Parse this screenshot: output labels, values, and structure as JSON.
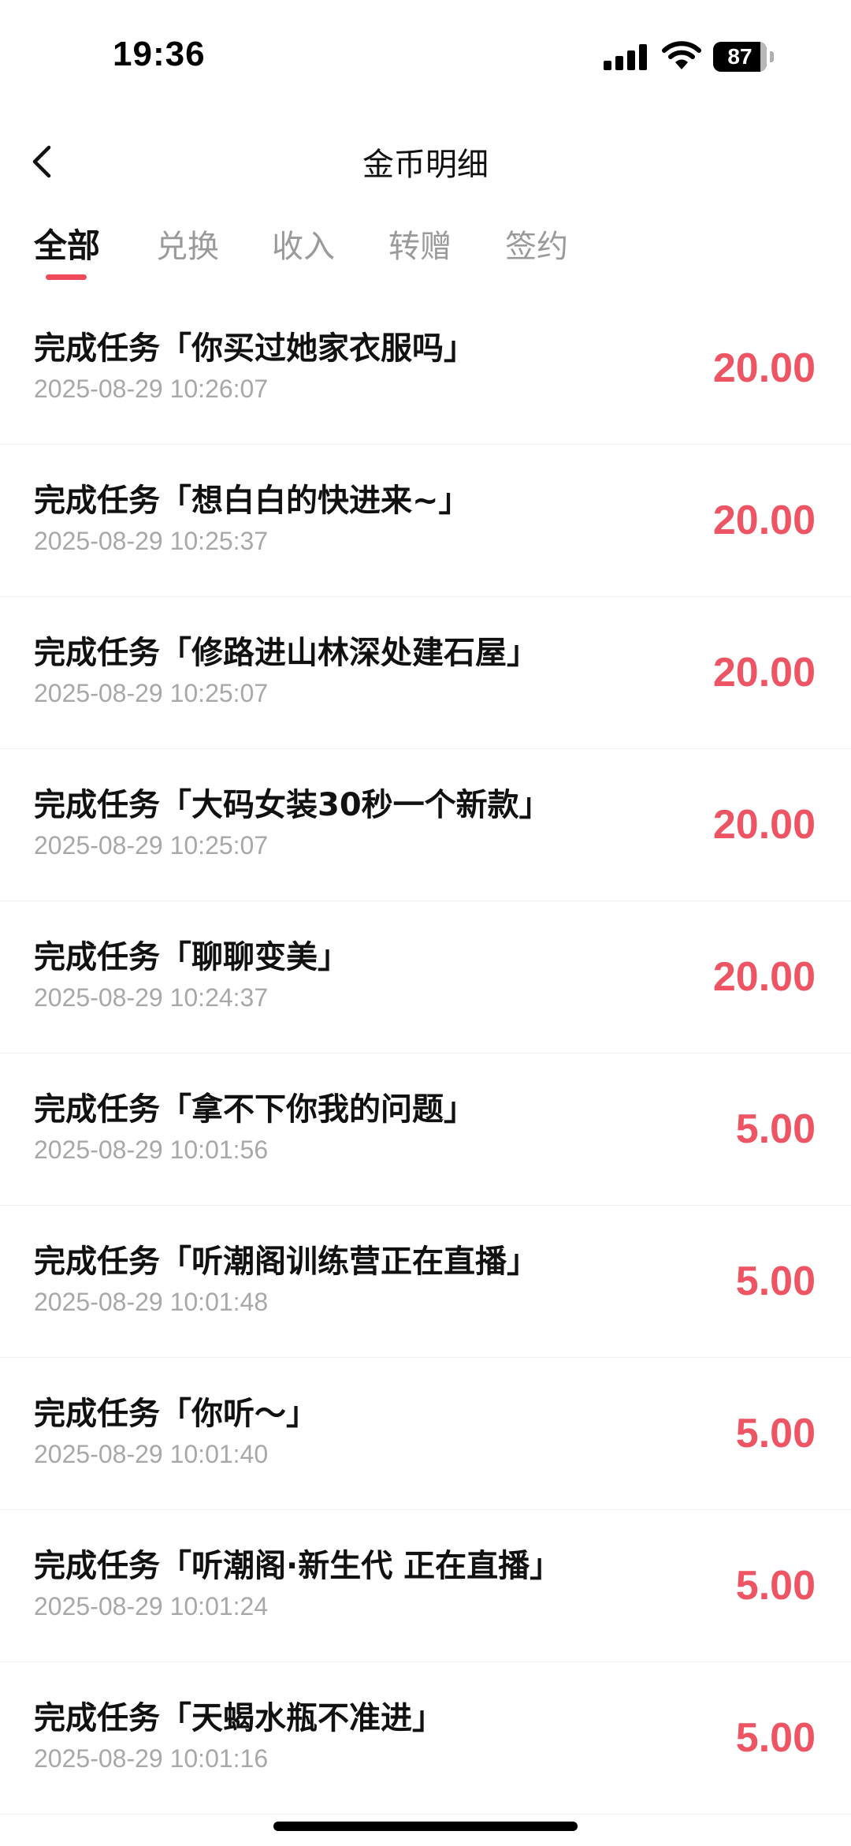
{
  "status_bar": {
    "time": "19:36",
    "battery": "87"
  },
  "header": {
    "title": "金币明细"
  },
  "tabs": [
    {
      "label": "全部",
      "active": true
    },
    {
      "label": "兑换",
      "active": false
    },
    {
      "label": "收入",
      "active": false
    },
    {
      "label": "转赠",
      "active": false
    },
    {
      "label": "签约",
      "active": false
    }
  ],
  "records": [
    {
      "title": "完成任务「你买过她家衣服吗」",
      "time": "2025-08-29 10:26:07",
      "amount": "20.00"
    },
    {
      "title": "完成任务「想白白的快进来~」",
      "time": "2025-08-29 10:25:37",
      "amount": "20.00"
    },
    {
      "title": "完成任务「修路进山林深处建石屋」",
      "time": "2025-08-29 10:25:07",
      "amount": "20.00"
    },
    {
      "title": "完成任务「大码女装30秒一个新款」",
      "time": "2025-08-29 10:25:07",
      "amount": "20.00"
    },
    {
      "title": "完成任务「聊聊变美」",
      "time": "2025-08-29 10:24:37",
      "amount": "20.00"
    },
    {
      "title": "完成任务「拿不下你我的问题」",
      "time": "2025-08-29 10:01:56",
      "amount": "5.00"
    },
    {
      "title": "完成任务「听潮阁训练营正在直播」",
      "time": "2025-08-29 10:01:48",
      "amount": "5.00"
    },
    {
      "title": "完成任务「你听～」",
      "time": "2025-08-29 10:01:40",
      "amount": "5.00"
    },
    {
      "title": "完成任务「听潮阁·新生代 正在直播」",
      "time": "2025-08-29 10:01:24",
      "amount": "5.00"
    },
    {
      "title": "完成任务「天蝎水瓶不准进」",
      "time": "2025-08-29 10:01:16",
      "amount": "5.00"
    }
  ],
  "colors": {
    "accent": "#ef4a5a",
    "amount": "#ee5564",
    "muted": "#a8a8a8"
  },
  "icons": {
    "back": "chevron-left-icon",
    "signal": "cellular-signal-icon",
    "wifi": "wifi-icon",
    "battery": "battery-icon"
  }
}
